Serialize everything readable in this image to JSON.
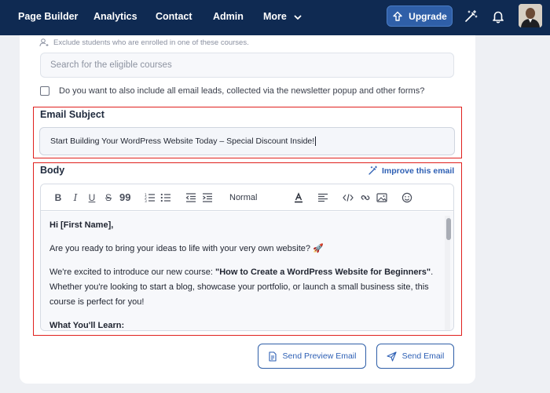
{
  "nav": {
    "items": [
      "Page Builder",
      "Analytics",
      "Contact",
      "Admin",
      "More"
    ],
    "upgrade_label": "Upgrade"
  },
  "audience": {
    "exclude_text": "Exclude students who are enrolled in one of these courses.",
    "search_placeholder": "Search for the eligible courses",
    "include_leads_label": "Do you want to also include all email leads, collected via the newsletter popup and other forms?"
  },
  "subject": {
    "label": "Email Subject",
    "value": "Start Building Your WordPress Website Today – Special Discount Inside!"
  },
  "body": {
    "label": "Body",
    "improve_label": "Improve this email",
    "format_select": "Normal",
    "greeting": "Hi [First Name],",
    "para1": "Are you ready to bring your ideas to life with your very own website? 🚀",
    "para2_prefix": "We're excited to introduce our new course: ",
    "para2_bold": "\"How to Create a WordPress Website for Beginners\"",
    "para2_suffix": ". Whether you're looking to start a blog, showcase your portfolio, or launch a small business site, this course is perfect for you!",
    "section_heading": "What You'll Learn:"
  },
  "actions": {
    "preview_label": "Send Preview Email",
    "send_label": "Send Email"
  },
  "colors": {
    "nav_bg": "#0f2a52",
    "accent": "#2d5fb4",
    "highlight_frame": "#e0201d"
  }
}
